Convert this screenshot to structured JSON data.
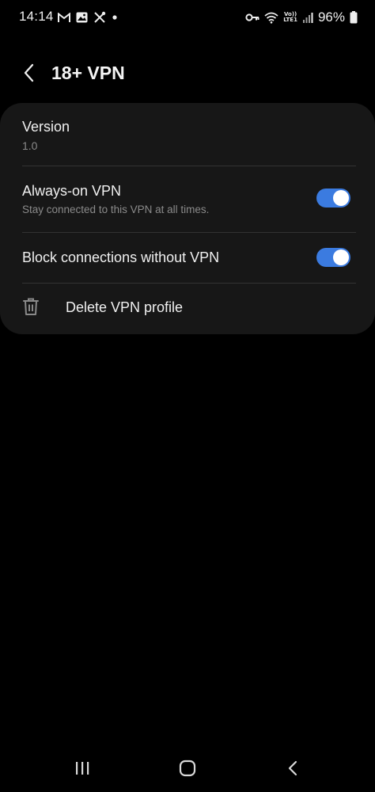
{
  "status_bar": {
    "time": "14:14",
    "battery": "96%",
    "left_icons": [
      "gmail-icon",
      "gallery-icon",
      "tools-icon",
      "notification-dot-icon"
    ],
    "right_icons": [
      "vpn-key-icon",
      "wifi-icon",
      "volte-icon",
      "signal-icon",
      "battery-icon"
    ],
    "volte_top": "Vo))",
    "volte_bottom": "LTE1"
  },
  "header": {
    "back_icon": "chevron-left-icon",
    "title": "18+ VPN"
  },
  "settings": {
    "version": {
      "title": "Version",
      "value": "1.0"
    },
    "always_on": {
      "title": "Always-on VPN",
      "subtitle": "Stay connected to this VPN at all times.",
      "enabled": true
    },
    "block_connections": {
      "title": "Block connections without VPN",
      "enabled": true
    },
    "delete_profile": {
      "icon": "trash-icon",
      "label": "Delete VPN profile"
    }
  },
  "colors": {
    "background": "#000000",
    "card": "#171717",
    "toggle_on": "#3b7be0",
    "text_primary": "#f0f0f0",
    "text_secondary": "#8a8a8a"
  },
  "nav_bar": {
    "buttons": [
      "recents-icon",
      "home-icon",
      "back-nav-icon"
    ]
  }
}
